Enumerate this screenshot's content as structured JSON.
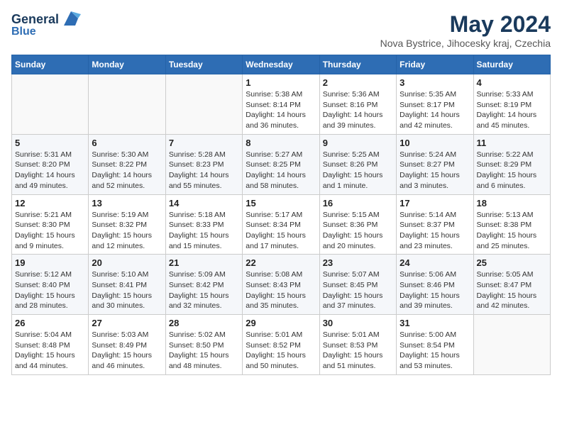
{
  "header": {
    "logo_line1": "General",
    "logo_line2": "Blue",
    "month": "May 2024",
    "location": "Nova Bystrice, Jihocesky kraj, Czechia"
  },
  "weekdays": [
    "Sunday",
    "Monday",
    "Tuesday",
    "Wednesday",
    "Thursday",
    "Friday",
    "Saturday"
  ],
  "weeks": [
    [
      {
        "day": "",
        "info": ""
      },
      {
        "day": "",
        "info": ""
      },
      {
        "day": "",
        "info": ""
      },
      {
        "day": "1",
        "info": "Sunrise: 5:38 AM\nSunset: 8:14 PM\nDaylight: 14 hours\nand 36 minutes."
      },
      {
        "day": "2",
        "info": "Sunrise: 5:36 AM\nSunset: 8:16 PM\nDaylight: 14 hours\nand 39 minutes."
      },
      {
        "day": "3",
        "info": "Sunrise: 5:35 AM\nSunset: 8:17 PM\nDaylight: 14 hours\nand 42 minutes."
      },
      {
        "day": "4",
        "info": "Sunrise: 5:33 AM\nSunset: 8:19 PM\nDaylight: 14 hours\nand 45 minutes."
      }
    ],
    [
      {
        "day": "5",
        "info": "Sunrise: 5:31 AM\nSunset: 8:20 PM\nDaylight: 14 hours\nand 49 minutes."
      },
      {
        "day": "6",
        "info": "Sunrise: 5:30 AM\nSunset: 8:22 PM\nDaylight: 14 hours\nand 52 minutes."
      },
      {
        "day": "7",
        "info": "Sunrise: 5:28 AM\nSunset: 8:23 PM\nDaylight: 14 hours\nand 55 minutes."
      },
      {
        "day": "8",
        "info": "Sunrise: 5:27 AM\nSunset: 8:25 PM\nDaylight: 14 hours\nand 58 minutes."
      },
      {
        "day": "9",
        "info": "Sunrise: 5:25 AM\nSunset: 8:26 PM\nDaylight: 15 hours\nand 1 minute."
      },
      {
        "day": "10",
        "info": "Sunrise: 5:24 AM\nSunset: 8:27 PM\nDaylight: 15 hours\nand 3 minutes."
      },
      {
        "day": "11",
        "info": "Sunrise: 5:22 AM\nSunset: 8:29 PM\nDaylight: 15 hours\nand 6 minutes."
      }
    ],
    [
      {
        "day": "12",
        "info": "Sunrise: 5:21 AM\nSunset: 8:30 PM\nDaylight: 15 hours\nand 9 minutes."
      },
      {
        "day": "13",
        "info": "Sunrise: 5:19 AM\nSunset: 8:32 PM\nDaylight: 15 hours\nand 12 minutes."
      },
      {
        "day": "14",
        "info": "Sunrise: 5:18 AM\nSunset: 8:33 PM\nDaylight: 15 hours\nand 15 minutes."
      },
      {
        "day": "15",
        "info": "Sunrise: 5:17 AM\nSunset: 8:34 PM\nDaylight: 15 hours\nand 17 minutes."
      },
      {
        "day": "16",
        "info": "Sunrise: 5:15 AM\nSunset: 8:36 PM\nDaylight: 15 hours\nand 20 minutes."
      },
      {
        "day": "17",
        "info": "Sunrise: 5:14 AM\nSunset: 8:37 PM\nDaylight: 15 hours\nand 23 minutes."
      },
      {
        "day": "18",
        "info": "Sunrise: 5:13 AM\nSunset: 8:38 PM\nDaylight: 15 hours\nand 25 minutes."
      }
    ],
    [
      {
        "day": "19",
        "info": "Sunrise: 5:12 AM\nSunset: 8:40 PM\nDaylight: 15 hours\nand 28 minutes."
      },
      {
        "day": "20",
        "info": "Sunrise: 5:10 AM\nSunset: 8:41 PM\nDaylight: 15 hours\nand 30 minutes."
      },
      {
        "day": "21",
        "info": "Sunrise: 5:09 AM\nSunset: 8:42 PM\nDaylight: 15 hours\nand 32 minutes."
      },
      {
        "day": "22",
        "info": "Sunrise: 5:08 AM\nSunset: 8:43 PM\nDaylight: 15 hours\nand 35 minutes."
      },
      {
        "day": "23",
        "info": "Sunrise: 5:07 AM\nSunset: 8:45 PM\nDaylight: 15 hours\nand 37 minutes."
      },
      {
        "day": "24",
        "info": "Sunrise: 5:06 AM\nSunset: 8:46 PM\nDaylight: 15 hours\nand 39 minutes."
      },
      {
        "day": "25",
        "info": "Sunrise: 5:05 AM\nSunset: 8:47 PM\nDaylight: 15 hours\nand 42 minutes."
      }
    ],
    [
      {
        "day": "26",
        "info": "Sunrise: 5:04 AM\nSunset: 8:48 PM\nDaylight: 15 hours\nand 44 minutes."
      },
      {
        "day": "27",
        "info": "Sunrise: 5:03 AM\nSunset: 8:49 PM\nDaylight: 15 hours\nand 46 minutes."
      },
      {
        "day": "28",
        "info": "Sunrise: 5:02 AM\nSunset: 8:50 PM\nDaylight: 15 hours\nand 48 minutes."
      },
      {
        "day": "29",
        "info": "Sunrise: 5:01 AM\nSunset: 8:52 PM\nDaylight: 15 hours\nand 50 minutes."
      },
      {
        "day": "30",
        "info": "Sunrise: 5:01 AM\nSunset: 8:53 PM\nDaylight: 15 hours\nand 51 minutes."
      },
      {
        "day": "31",
        "info": "Sunrise: 5:00 AM\nSunset: 8:54 PM\nDaylight: 15 hours\nand 53 minutes."
      },
      {
        "day": "",
        "info": ""
      }
    ]
  ]
}
